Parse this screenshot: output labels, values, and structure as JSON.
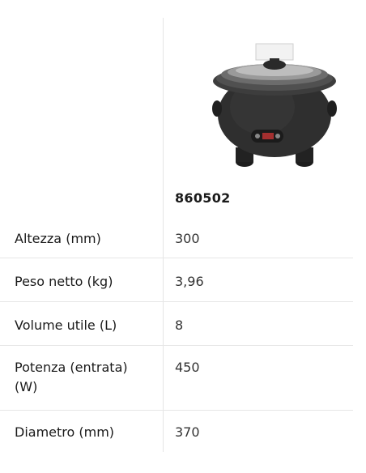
{
  "product": {
    "code": "860502",
    "image_icon": "soup-kettle-image"
  },
  "specs": [
    {
      "label": "Altezza (mm)",
      "value": "300"
    },
    {
      "label": "Peso netto (kg)",
      "value": "3,96"
    },
    {
      "label": "Volume utile (L)",
      "value": "8"
    },
    {
      "label": "Potenza (entrata) (W)",
      "value": "450"
    },
    {
      "label": "Diametro (mm)",
      "value": "370"
    }
  ],
  "colors": {
    "divider": "#e6e6e6",
    "kettle_body": "#2b2b2b",
    "text": "#1a1a1a"
  }
}
